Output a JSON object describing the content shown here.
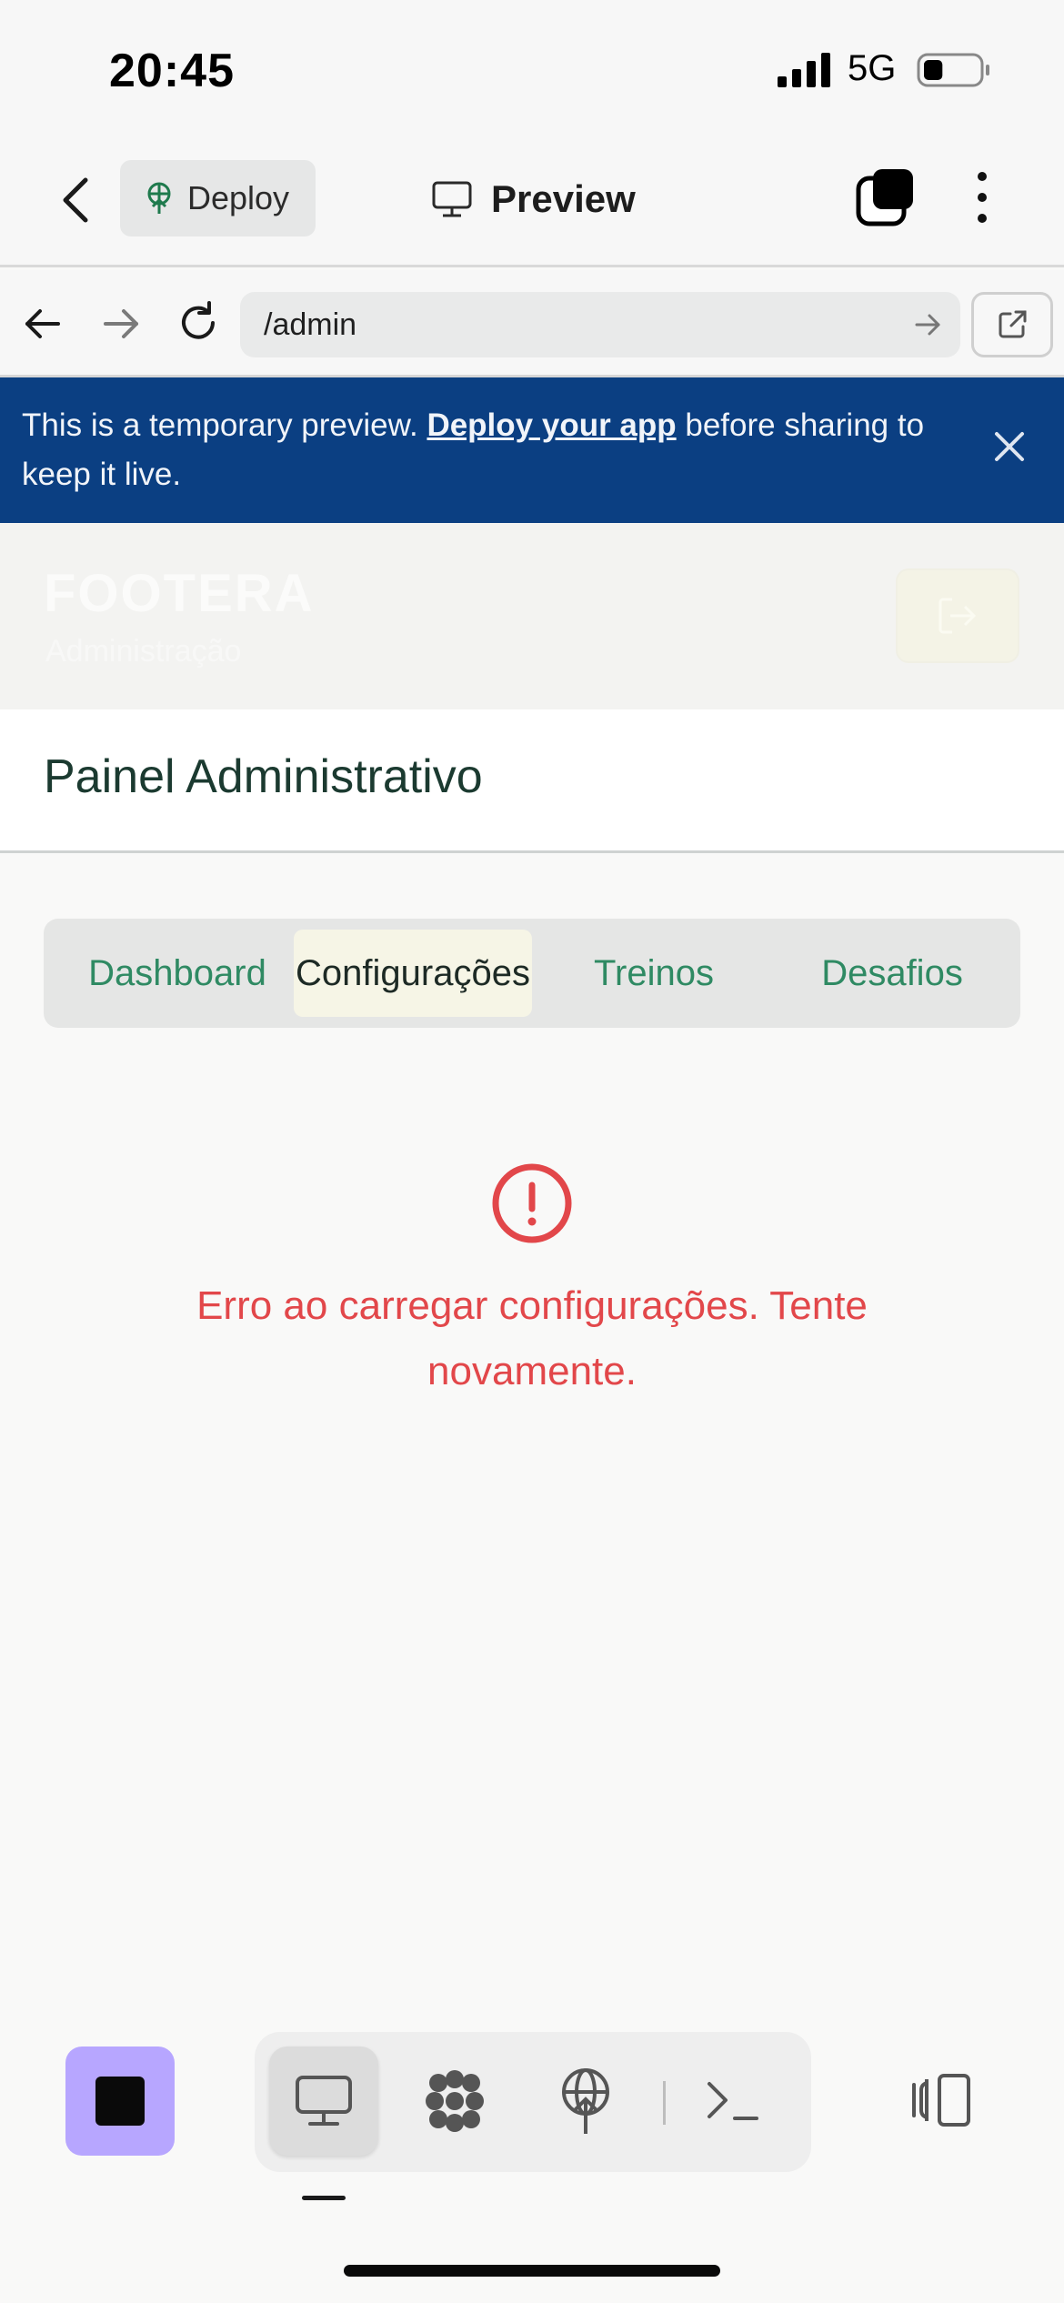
{
  "status_bar": {
    "time": "20:45",
    "network": "5G",
    "battery_level": 0.35
  },
  "header": {
    "deploy_label": "Deploy",
    "preview_label": "Preview"
  },
  "browser": {
    "url": "/admin"
  },
  "banner": {
    "text_before": "This is a temporary preview. ",
    "link_label": "Deploy your app",
    "text_after": " before sharing to keep it live."
  },
  "hero": {
    "logo": "FOOTERA",
    "subtitle": "Administração"
  },
  "panel": {
    "title": "Painel Administrativo"
  },
  "tabs": [
    {
      "label": "Dashboard",
      "active": false
    },
    {
      "label": "Configurações",
      "active": true
    },
    {
      "label": "Treinos",
      "active": false
    },
    {
      "label": "Desafios",
      "active": false
    }
  ],
  "error": {
    "message": "Erro ao carregar configurações. Tente novamente."
  },
  "toolbar": {
    "icons": [
      "stop-icon",
      "preview-icon",
      "workspace-icon",
      "deploy-icon",
      "terminal-icon",
      "panel-icon"
    ],
    "active_tool": "preview-icon"
  },
  "colors": {
    "banner_bg": "#0b3f82",
    "accent_green": "#2f8a63",
    "error_red": "#e2474a",
    "stop_button": "#b7a6ff"
  }
}
